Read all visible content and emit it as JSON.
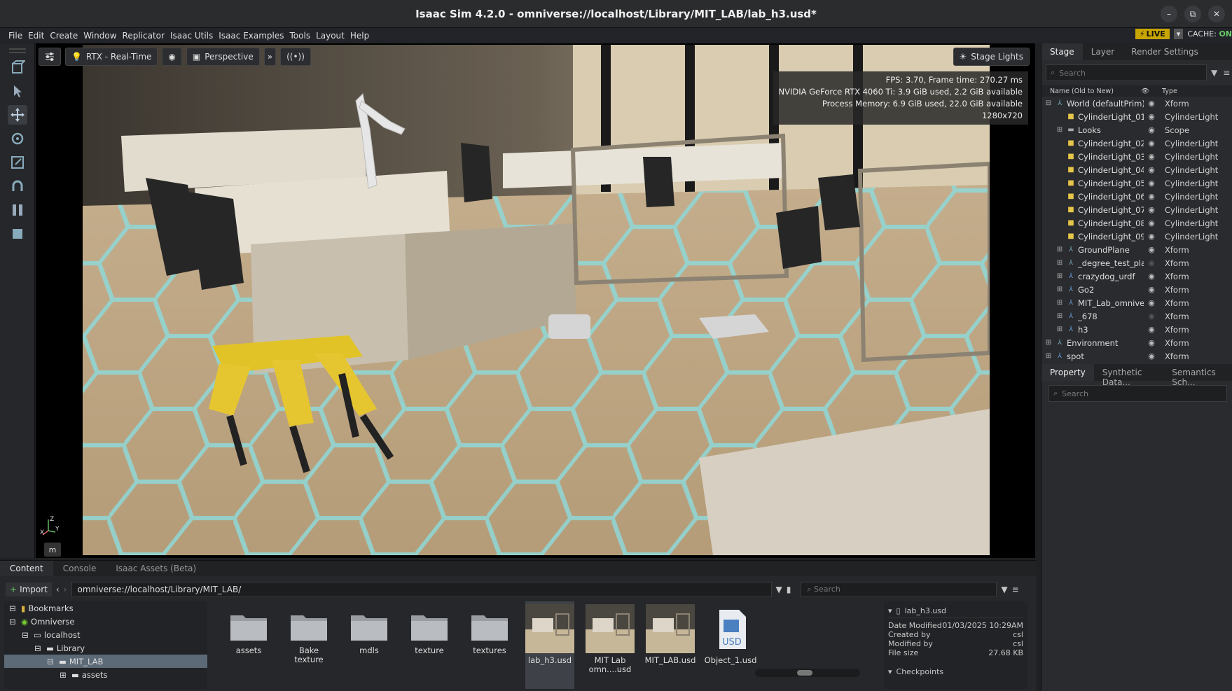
{
  "window": {
    "title": "Isaac Sim 4.2.0 - omniverse://localhost/Library/MIT_LAB/lab_h3.usd*",
    "minimize": "–",
    "restore": "⧉",
    "close": "✕"
  },
  "menu": {
    "items": [
      "File",
      "Edit",
      "Create",
      "Window",
      "Replicator",
      "Isaac Utils",
      "Isaac Examples",
      "Tools",
      "Layout",
      "Help"
    ],
    "live_label": "LIVE",
    "cache_label": "CACHE:",
    "cache_status": "ON"
  },
  "viewport": {
    "render_mode": "RTX - Real-Time",
    "camera": "Perspective",
    "stage_lights": "Stage Lights",
    "stats": [
      "FPS: 3.70, Frame time: 270.27 ms",
      "NVIDIA GeForce RTX 4060 Ti: 3.9 GiB used, 2.2 GiB available",
      "Process Memory: 6.9 GiB used, 22.0 GiB available",
      "1280x720"
    ],
    "axis_z": "Z",
    "axis_x": "X",
    "axis_y": "Y",
    "units_button": "m"
  },
  "stage": {
    "tabs": [
      "Stage",
      "Layer",
      "Render Settings"
    ],
    "search_placeholder": "Search",
    "col_name": "Name (Old to New)",
    "col_type": "Type",
    "rows": [
      {
        "name": "World (defaultPrim)",
        "type": "Xform"
      },
      {
        "name": "CylinderLight_01",
        "type": "CylinderLight"
      },
      {
        "name": "Looks",
        "type": "Scope"
      },
      {
        "name": "CylinderLight_02",
        "type": "CylinderLight"
      },
      {
        "name": "CylinderLight_03",
        "type": "CylinderLight"
      },
      {
        "name": "CylinderLight_04",
        "type": "CylinderLight"
      },
      {
        "name": "CylinderLight_05",
        "type": "CylinderLight"
      },
      {
        "name": "CylinderLight_06",
        "type": "CylinderLight"
      },
      {
        "name": "CylinderLight_07",
        "type": "CylinderLight"
      },
      {
        "name": "CylinderLight_08",
        "type": "CylinderLight"
      },
      {
        "name": "CylinderLight_09",
        "type": "CylinderLight"
      },
      {
        "name": "GroundPlane",
        "type": "Xform"
      },
      {
        "name": "_degree_test_plat",
        "type": "Xform"
      },
      {
        "name": "crazydog_urdf",
        "type": "Xform"
      },
      {
        "name": "Go2",
        "type": "Xform"
      },
      {
        "name": "MIT_Lab_omnive",
        "type": "Xform"
      },
      {
        "name": "_678",
        "type": "Xform"
      },
      {
        "name": "h3",
        "type": "Xform"
      },
      {
        "name": "Environment",
        "type": "Xform"
      },
      {
        "name": "spot",
        "type": "Xform"
      }
    ]
  },
  "property": {
    "tabs": [
      "Property",
      "Synthetic Data...",
      "Semantics Sch..."
    ],
    "search_placeholder": "Search"
  },
  "content": {
    "tabs": [
      "Content",
      "Console",
      "Isaac Assets (Beta)"
    ],
    "import_label": "Import",
    "path": "omniverse://localhost/Library/MIT_LAB/",
    "search_placeholder": "Search",
    "tree": [
      {
        "label": "Bookmarks"
      },
      {
        "label": "Omniverse"
      },
      {
        "label": "localhost"
      },
      {
        "label": "Library"
      },
      {
        "label": "MIT_LAB"
      },
      {
        "label": "assets"
      }
    ],
    "files": [
      {
        "name": "assets",
        "kind": "folder"
      },
      {
        "name": "Bake texture",
        "kind": "folder"
      },
      {
        "name": "mdls",
        "kind": "folder"
      },
      {
        "name": "texture",
        "kind": "folder"
      },
      {
        "name": "textures",
        "kind": "folder"
      },
      {
        "name": "lab_h3.usd",
        "kind": "thumb"
      },
      {
        "name": "MIT Lab omn....usd",
        "kind": "thumb"
      },
      {
        "name": "MIT_LAB.usd",
        "kind": "thumb"
      },
      {
        "name": "Object_1.usd",
        "kind": "usd"
      }
    ],
    "details": {
      "filename": "lab_h3.usd",
      "date_label": "Date Modified",
      "date_value": "01/03/2025 10:29AM",
      "created_label": "Created by",
      "created_value": "csl",
      "modified_label": "Modified by",
      "modified_value": "csl",
      "size_label": "File size",
      "size_value": "27.68 KB",
      "checkpoints": "Checkpoints"
    }
  }
}
